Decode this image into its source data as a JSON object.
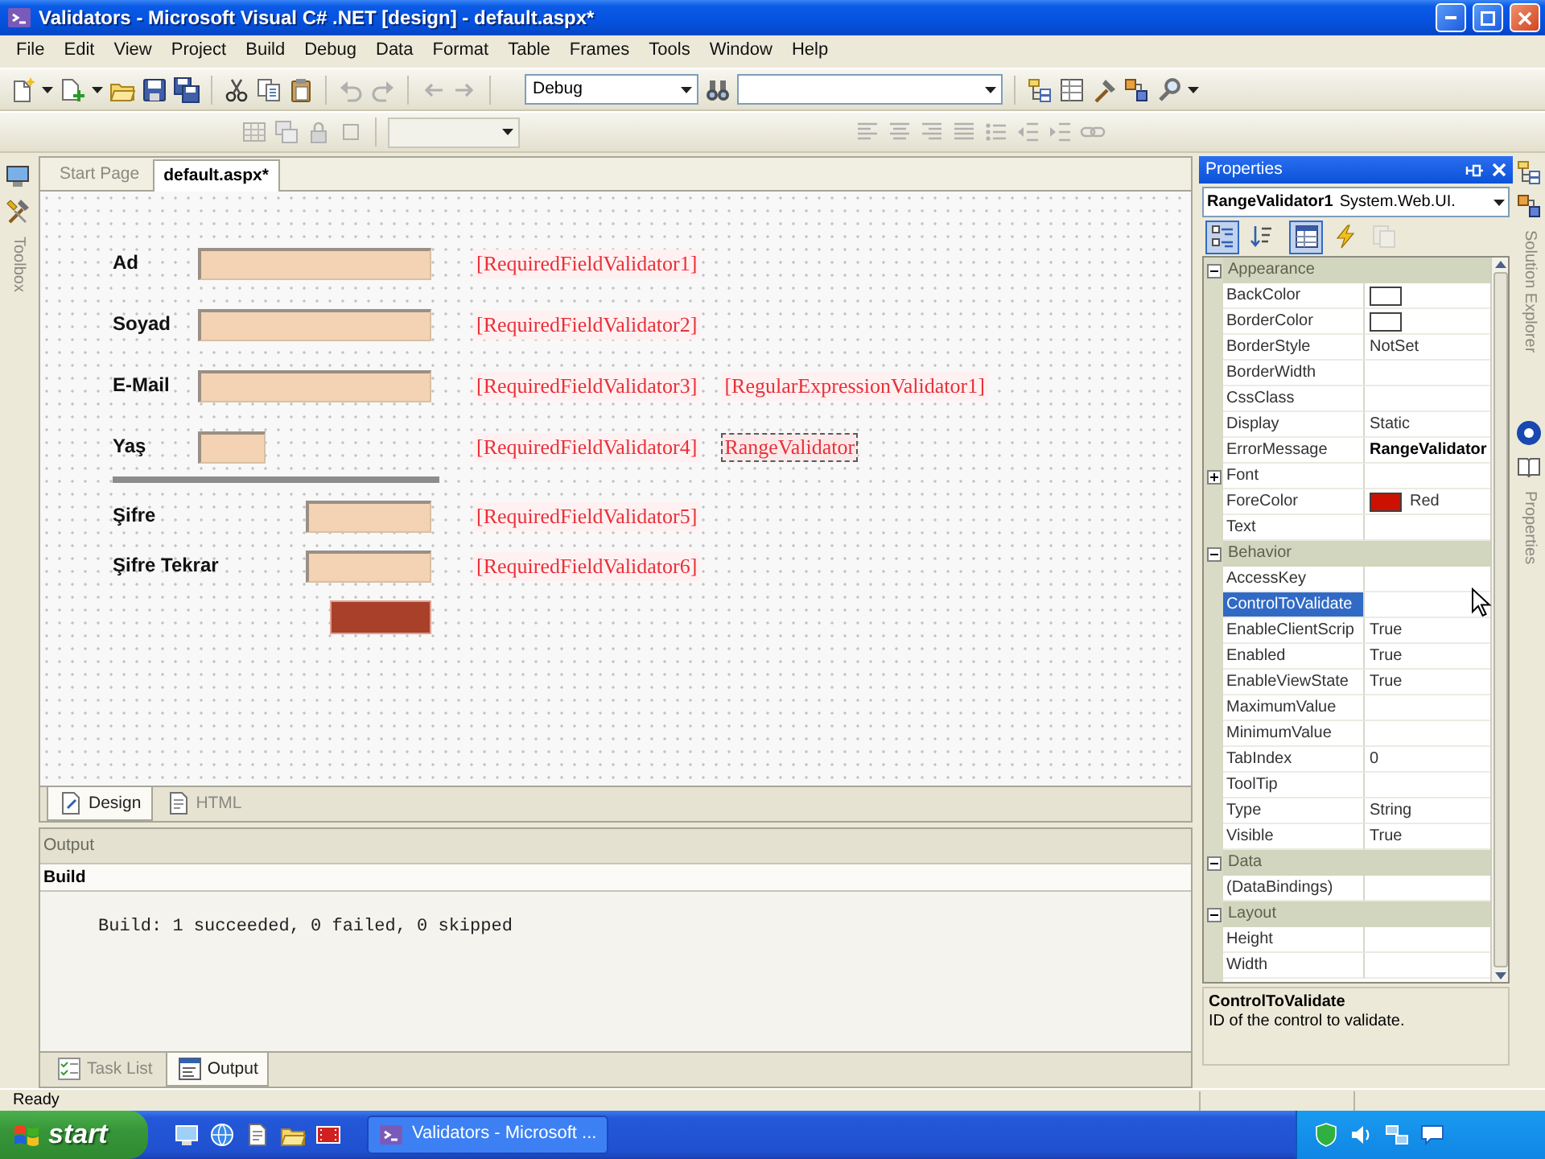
{
  "window": {
    "title": "Validators - Microsoft Visual C# .NET [design] - default.aspx*"
  },
  "menu": [
    "File",
    "Edit",
    "View",
    "Project",
    "Build",
    "Debug",
    "Data",
    "Format",
    "Table",
    "Frames",
    "Tools",
    "Window",
    "Help"
  ],
  "toolbar": {
    "configuration": "Debug"
  },
  "document_tabs": [
    {
      "label": "Start Page",
      "selected": false
    },
    {
      "label": "default.aspx*",
      "selected": true
    }
  ],
  "form": [
    {
      "kind": "text",
      "label": "Ad",
      "validators": [
        {
          "text": "[RequiredFieldValidator1]",
          "selected": false
        }
      ]
    },
    {
      "kind": "text",
      "label": "Soyad",
      "validators": [
        {
          "text": "[RequiredFieldValidator2]",
          "selected": false
        }
      ]
    },
    {
      "kind": "text",
      "label": "E-Mail",
      "validators": [
        {
          "text": "[RequiredFieldValidator3]",
          "selected": false
        },
        {
          "text": "[RegularExpressionValidator1]",
          "selected": false
        }
      ]
    },
    {
      "kind": "short",
      "label": "Yaş",
      "validators": [
        {
          "text": "[RequiredFieldValidator4]",
          "selected": false
        },
        {
          "text": "RangeValidator",
          "selected": true
        }
      ]
    },
    {
      "kind": "rule"
    },
    {
      "kind": "password",
      "label": "Şifre",
      "validators": [
        {
          "text": "[RequiredFieldValidator5]",
          "selected": false
        }
      ]
    },
    {
      "kind": "password",
      "label": "Şifre Tekrar",
      "validators": [
        {
          "text": "[RequiredFieldValidator6]",
          "selected": false
        }
      ]
    },
    {
      "kind": "button"
    }
  ],
  "view_tabs": [
    {
      "label": "Design",
      "selected": true
    },
    {
      "label": "HTML",
      "selected": false
    }
  ],
  "output": {
    "title": "Output",
    "pane": "Build",
    "lines": [
      "Build: 1 succeeded, 0 failed, 0 skipped"
    ]
  },
  "output_tabs": [
    {
      "label": "Task List",
      "selected": false
    },
    {
      "label": "Output",
      "selected": true
    }
  ],
  "properties": {
    "title": "Properties",
    "object": "RangeValidator1",
    "object_type": "System.Web.UI.",
    "buttons": [
      {
        "kind": "categorized",
        "selected": true,
        "disabled": false
      },
      {
        "kind": "alphabetical",
        "selected": false,
        "disabled": false
      },
      {
        "kind": "properties",
        "selected": true,
        "disabled": false
      },
      {
        "kind": "events",
        "selected": false,
        "disabled": false
      },
      {
        "kind": "pages",
        "selected": false,
        "disabled": true
      }
    ],
    "categories": [
      {
        "name": "Appearance",
        "expanded": true,
        "rows": [
          {
            "name": "BackColor",
            "kind": "color",
            "selected": false
          },
          {
            "name": "BorderColor",
            "kind": "color",
            "selected": false
          },
          {
            "name": "BorderStyle",
            "kind": "text",
            "value": "NotSet",
            "modified": false,
            "selected": false
          },
          {
            "name": "BorderWidth",
            "kind": "text",
            "selected": false
          },
          {
            "name": "CssClass",
            "kind": "text",
            "selected": false
          },
          {
            "name": "Display",
            "kind": "text",
            "value": "Static",
            "modified": false,
            "selected": false
          },
          {
            "name": "ErrorMessage",
            "kind": "text",
            "value": "RangeValidator",
            "modified": true,
            "selected": false
          },
          {
            "name": "Font",
            "kind": "group",
            "expanded": false,
            "selected": false
          },
          {
            "name": "ForeColor",
            "kind": "color",
            "color": "#cc1100",
            "value": "Red",
            "selected": false
          },
          {
            "name": "Text",
            "kind": "text",
            "selected": false
          }
        ]
      },
      {
        "name": "Behavior",
        "expanded": true,
        "rows": [
          {
            "name": "AccessKey",
            "kind": "text",
            "selected": false
          },
          {
            "name": "ControlToValidate",
            "kind": "text",
            "selected": true
          },
          {
            "name": "EnableClientScrip",
            "kind": "text",
            "value": "True",
            "modified": false,
            "selected": false
          },
          {
            "name": "Enabled",
            "kind": "text",
            "value": "True",
            "modified": false,
            "selected": false
          },
          {
            "name": "EnableViewState",
            "kind": "text",
            "value": "True",
            "modified": false,
            "selected": false
          },
          {
            "name": "MaximumValue",
            "kind": "text",
            "selected": false
          },
          {
            "name": "MinimumValue",
            "kind": "text",
            "selected": false
          },
          {
            "name": "TabIndex",
            "kind": "text",
            "value": "0",
            "modified": false,
            "selected": false
          },
          {
            "name": "ToolTip",
            "kind": "text",
            "selected": false
          },
          {
            "name": "Type",
            "kind": "text",
            "value": "String",
            "modified": false,
            "selected": false
          },
          {
            "name": "Visible",
            "kind": "text",
            "value": "True",
            "modified": false,
            "selected": false
          }
        ]
      },
      {
        "name": "Data",
        "expanded": true,
        "rows": [
          {
            "name": "(DataBindings)",
            "kind": "text",
            "selected": false
          }
        ]
      },
      {
        "name": "Layout",
        "expanded": true,
        "rows": [
          {
            "name": "Height",
            "kind": "text",
            "selected": false
          },
          {
            "name": "Width",
            "kind": "text",
            "selected": false
          }
        ]
      }
    ],
    "description": {
      "title": "ControlToValidate",
      "text": "ID of the control to validate."
    }
  },
  "side_tabs": {
    "left": [
      "Toolbox"
    ],
    "right": [
      "Solution Explorer",
      "Properties"
    ]
  },
  "status_bar": {
    "text": "Ready"
  },
  "taskbar": {
    "start": "start",
    "tasks": [
      "Validators - Microsoft ..."
    ]
  }
}
